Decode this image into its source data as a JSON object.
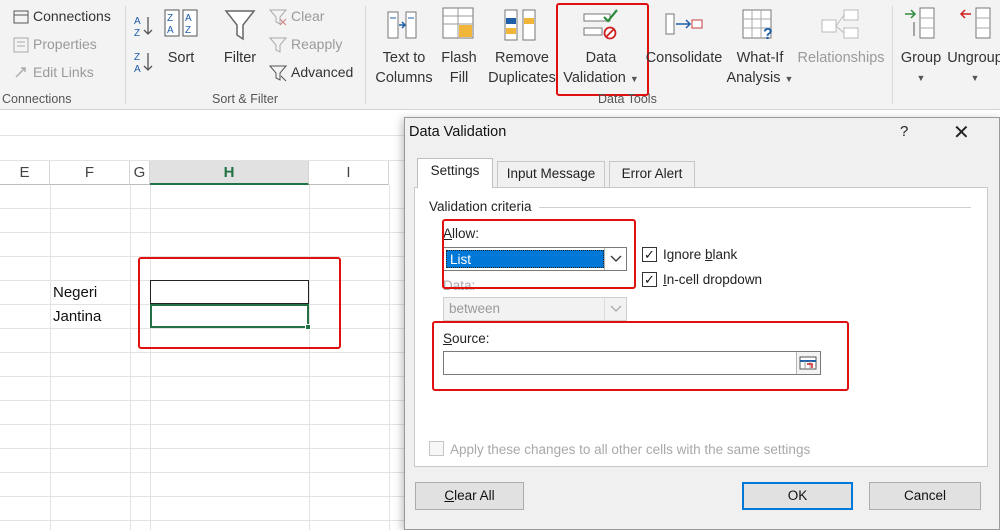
{
  "ribbon": {
    "connections": {
      "connections": "Connections",
      "properties": "Properties",
      "edit_links": "Edit Links",
      "group_label": "Connections"
    },
    "sort_filter": {
      "sort": "Sort",
      "filter": "Filter",
      "clear": "Clear",
      "reapply": "Reapply",
      "advanced": "Advanced",
      "group_label": "Sort & Filter"
    },
    "data_tools": {
      "text_to_columns_1": "Text to",
      "text_to_columns_2": "Columns",
      "flash_fill_1": "Flash",
      "flash_fill_2": "Fill",
      "remove_dup_1": "Remove",
      "remove_dup_2": "Duplicates",
      "data_validation_1": "Data",
      "data_validation_2": "Validation",
      "consolidate": "Consolidate",
      "what_if_1": "What-If",
      "what_if_2": "Analysis",
      "relationships": "Relationships",
      "group_label": "Data Tools"
    },
    "outline": {
      "group": "Group",
      "ungroup": "Ungroup"
    }
  },
  "sheet": {
    "columns": [
      "E",
      "F",
      "G",
      "H",
      "I"
    ],
    "selected_column": "H",
    "cells": {
      "negeri": "Negeri",
      "jantina": "Jantina",
      "colon": ":"
    }
  },
  "dialog": {
    "title": "Data Validation",
    "help": "?",
    "tabs": [
      "Settings",
      "Input Message",
      "Error Alert"
    ],
    "active_tab": "Settings",
    "section": "Validation criteria",
    "allow_label": "Allow:",
    "allow_value": "List",
    "data_label": "Data:",
    "data_value": "between",
    "ignore_blank": "Ignore blank",
    "in_cell_dropdown": "In-cell dropdown",
    "source_label": "Source:",
    "source_value": "",
    "apply_all": "Apply these changes to all other cells with the same settings",
    "clear_all": "Clear All",
    "ok": "OK",
    "cancel": "Cancel"
  },
  "colors": {
    "highlight": "#e01010",
    "excel_green": "#217346",
    "selection_blue": "#0078d7"
  }
}
